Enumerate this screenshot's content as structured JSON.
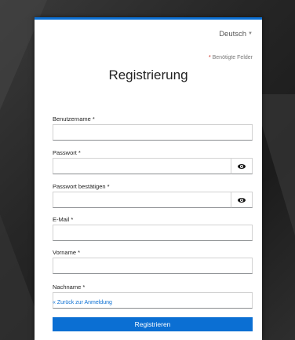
{
  "header": {
    "language": "Deutsch",
    "required_star": "*",
    "required_text": "Benötigte Felder",
    "title": "Registrierung"
  },
  "fields": [
    {
      "label": "Benutzername *",
      "value": ""
    },
    {
      "label": "Passwort *",
      "value": ""
    },
    {
      "label": "Passwort bestätigen *",
      "value": ""
    },
    {
      "label": "E-Mail *",
      "value": ""
    },
    {
      "label": "Vorname *",
      "value": ""
    },
    {
      "label": "Nachname *",
      "value": ""
    }
  ],
  "links": {
    "back": "« Zurück zur Anmeldung"
  },
  "buttons": {
    "submit": "Registrieren"
  },
  "colors": {
    "accent": "#0b6fd3",
    "required_star": "#c9190b"
  },
  "icons": {
    "password_toggle": "eye-icon",
    "language_caret": "caret-down-icon"
  }
}
